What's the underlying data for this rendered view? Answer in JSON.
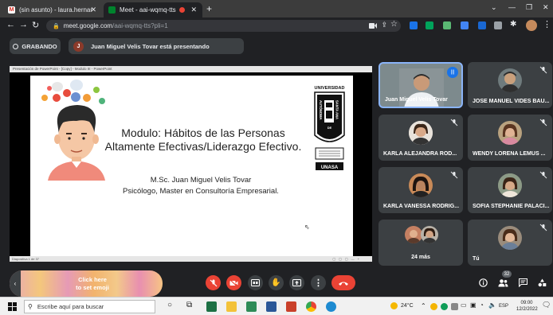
{
  "browser": {
    "tabs": [
      {
        "label": "(sin asunto) - laura.hernandez@...",
        "icon": "gmail-icon"
      },
      {
        "label": "Meet - aai-wqmq-tts",
        "icon": "meet-icon"
      }
    ],
    "url_host": "meet.google.com",
    "url_path": "/aai-wqmq-tts?pli=1"
  },
  "meet": {
    "recording_label": "GRABANDO",
    "presenter_initial": "J",
    "presenting_text": "Juan Miguel Velis Tovar está presentando"
  },
  "presentation": {
    "window_title": "Presentación de PowerPoint - [Copy] - Modulo III - PowerPoint",
    "title_line1": "Modulo: Hábitos de las Personas",
    "title_line2": "Altamente Efectivas/Liderazgo Efectivo.",
    "author": "M.Sc. Juan Miguel Velis Tovar",
    "role": "Psicólogo, Master en Consultoría Empresarial.",
    "logo_top": "UNIVERSIDAD",
    "logo_left": "AUTÓNOMA",
    "logo_right": "SANTA ANA",
    "logo_de": "DE",
    "logo_bottom": "UNASA",
    "status": "Diapositiva 1 de 37"
  },
  "participants": [
    {
      "name": "Juan Miguel Velis Tovar",
      "speaking": true
    },
    {
      "name": "JOSE MANUEL VIDES BAU..."
    },
    {
      "name": "KARLA ALEJANDRA ROD..."
    },
    {
      "name": "WENDY LORENA LEMUS ..."
    },
    {
      "name": "KARLA VANESSA RODRIG..."
    },
    {
      "name": "SOFIA STEPHANIE PALACI..."
    },
    {
      "name": "24 más"
    },
    {
      "name": "Tú"
    }
  ],
  "controls": {
    "emoji_line1": "Click here",
    "emoji_line2": "to set emoji",
    "people_count": "32"
  },
  "taskbar": {
    "search_placeholder": "Escribe aquí para buscar",
    "weather": "24°C",
    "lang": "ESP",
    "time": "09:00",
    "date": "12/2/2022"
  },
  "colors": {
    "meet_bg": "#202124",
    "tile_bg": "#3c4043",
    "danger": "#ea4335",
    "accent": "#1a73e8"
  }
}
